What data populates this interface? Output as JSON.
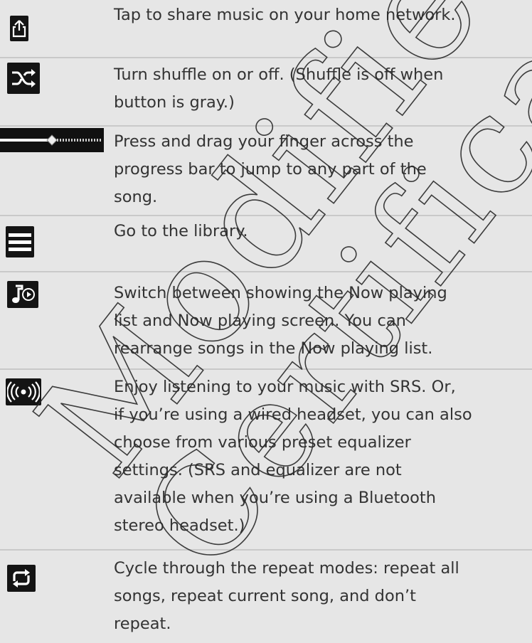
{
  "rows": [
    {
      "icon": "share-icon",
      "lines": [
        "Tap to share music on your home network."
      ]
    },
    {
      "icon": "shuffle-icon",
      "lines": [
        "Turn shuffle on or off. (Shuffle is off when",
        "button is gray.)"
      ]
    },
    {
      "icon": "progress-bar-icon",
      "progress": 0.5,
      "lines": [
        "Press and drag your finger across the",
        "progress bar to jump to any part of the",
        "song."
      ]
    },
    {
      "icon": "library-icon",
      "lines": [
        "Go to the library."
      ]
    },
    {
      "icon": "now-playing-toggle-icon",
      "lines": [
        "Switch between showing the Now playing",
        "list and Now playing screen. You can",
        "rearrange songs in the Now playing list."
      ]
    },
    {
      "icon": "srs-sound-icon",
      "lines": [
        "Enjoy listening to your music with SRS. Or,",
        "if you’re using a wired headset, you can also",
        "choose from various preset equalizer",
        "settings. (SRS and equalizer are not",
        "available when you’re using a Bluetooth",
        "stereo headset.)"
      ]
    },
    {
      "icon": "repeat-icon",
      "lines": [
        "Cycle through the repeat modes: repeat all",
        "songs, repeat current song, and don’t",
        "repeat."
      ]
    }
  ],
  "watermark": {
    "text": "Modified Certification Copy",
    "color": "#2a2a2a"
  }
}
